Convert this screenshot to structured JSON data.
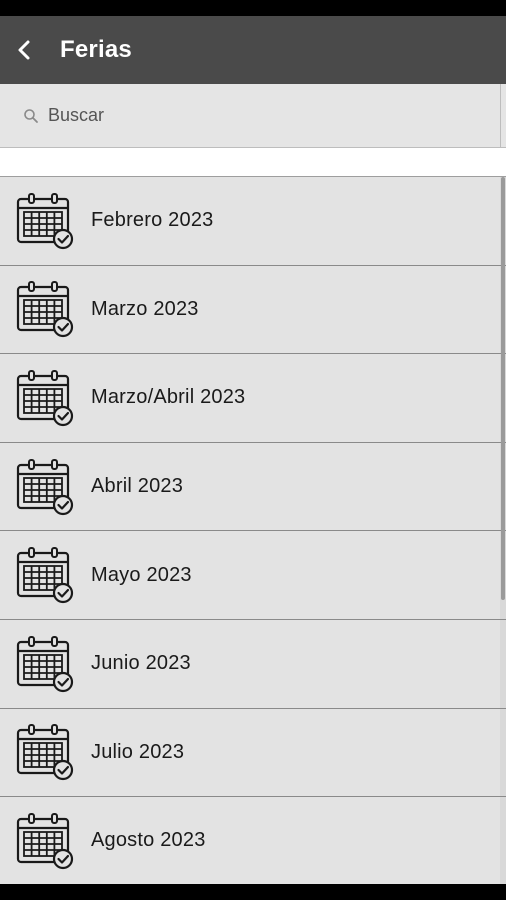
{
  "header": {
    "title": "Ferias",
    "back_icon": "chevron-left-icon",
    "background_color": "#4a4a4a"
  },
  "search": {
    "placeholder": "Buscar",
    "value": "",
    "icon": "search-icon"
  },
  "list": {
    "item_icon": "calendar-check-icon",
    "items": [
      {
        "label": "Febrero 2023"
      },
      {
        "label": "Marzo 2023"
      },
      {
        "label": "Marzo/Abril 2023"
      },
      {
        "label": "Abril 2023"
      },
      {
        "label": "Mayo 2023"
      },
      {
        "label": "Junio 2023"
      },
      {
        "label": "Julio 2023"
      },
      {
        "label": "Agosto 2023"
      }
    ]
  }
}
